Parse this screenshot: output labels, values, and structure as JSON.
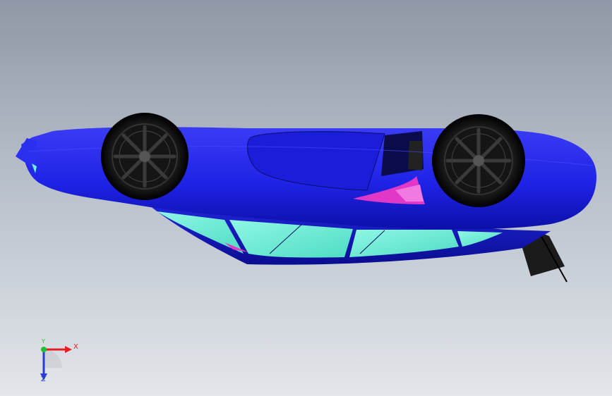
{
  "triad": {
    "x_label": "X",
    "y_label": "Y",
    "z_label": "Z"
  },
  "colors": {
    "body": "#1f23e6",
    "body_dark": "#0a0d9a",
    "glass": "#6ff0d8",
    "accent": "#e238c8",
    "tire": "#111111",
    "rim": "#2a2a2a",
    "axis_x": "#e52020",
    "axis_y": "#22c030",
    "axis_z": "#2a3cd6"
  }
}
